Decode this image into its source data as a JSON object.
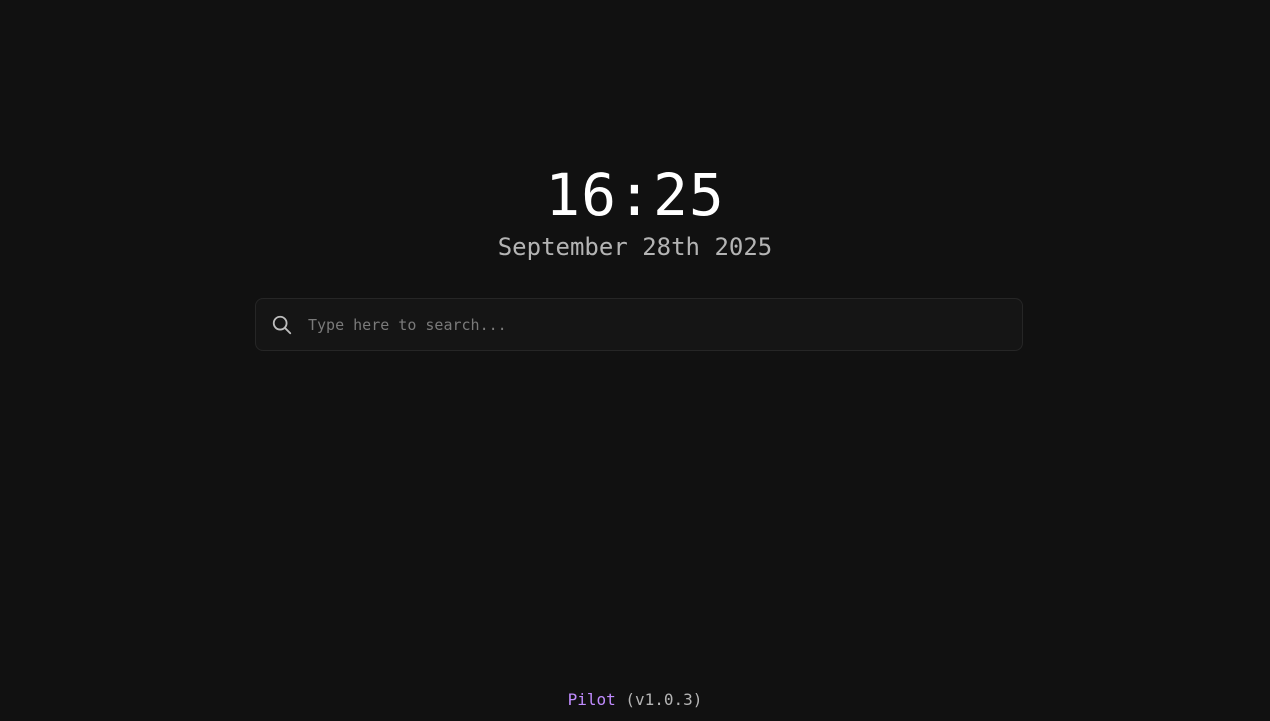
{
  "clock": {
    "time": "16:25",
    "date": "September 28th 2025"
  },
  "search": {
    "placeholder": "Type here to search...",
    "value": "",
    "icon": "search-icon"
  },
  "footer": {
    "app_name": "Pilot",
    "version": "(v1.0.3)"
  },
  "colors": {
    "background": "#111111",
    "accent": "#c08cff",
    "primary_text": "#ffffff",
    "secondary_text": "#b4b4b4"
  }
}
